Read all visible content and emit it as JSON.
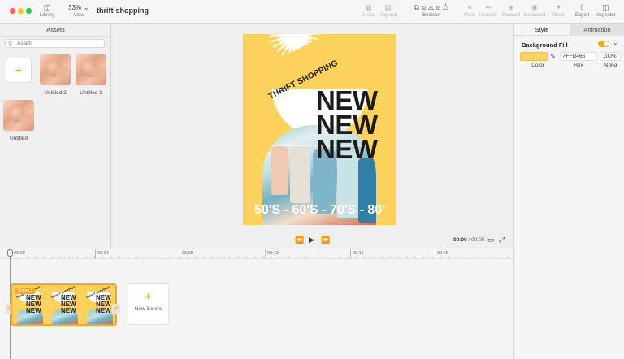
{
  "window": {
    "title": "thrift-shopping"
  },
  "toolbar": {
    "library": "Library",
    "zoom": "33%",
    "view": "View",
    "group": "Group",
    "ungroup": "Ungroup",
    "boolean": "Boolean",
    "mask": "Mask",
    "unmask": "Unmask",
    "forward": "Forward",
    "backward": "Backward",
    "morph": "Morph",
    "export": "Export",
    "inspector": "Inspector"
  },
  "assets": {
    "title": "Assets",
    "search_placeholder": "Assets",
    "items": [
      {
        "label": "Untitled 2"
      },
      {
        "label": "Untitled 1"
      },
      {
        "label": "Untitled"
      }
    ]
  },
  "poster": {
    "banner": "THRIFT SHOPPING",
    "headline": [
      "NEW",
      "NEW",
      "NEW"
    ],
    "decades": "50'S - 60'S - 70'S - 80'",
    "background": "#fcd25c"
  },
  "player": {
    "current_time": "00:00",
    "total_time": "/ 00:05"
  },
  "inspector": {
    "tab_style": "Style",
    "tab_animation": "Animation",
    "background_fill": "Background Fill",
    "hex_value": "#FFD466",
    "alpha_value": "100%",
    "color_label": "Color",
    "hex_label": "Hex",
    "alpha_label": "Alpha",
    "swatch_color": "#ffd466",
    "accent": "#f5a623"
  },
  "timeline": {
    "ticks": [
      "00:00",
      "00:04",
      "00:08",
      "00:12",
      "00:16",
      "00:20"
    ],
    "scene_label": "Scene 1",
    "new_scene": "New Scene"
  }
}
